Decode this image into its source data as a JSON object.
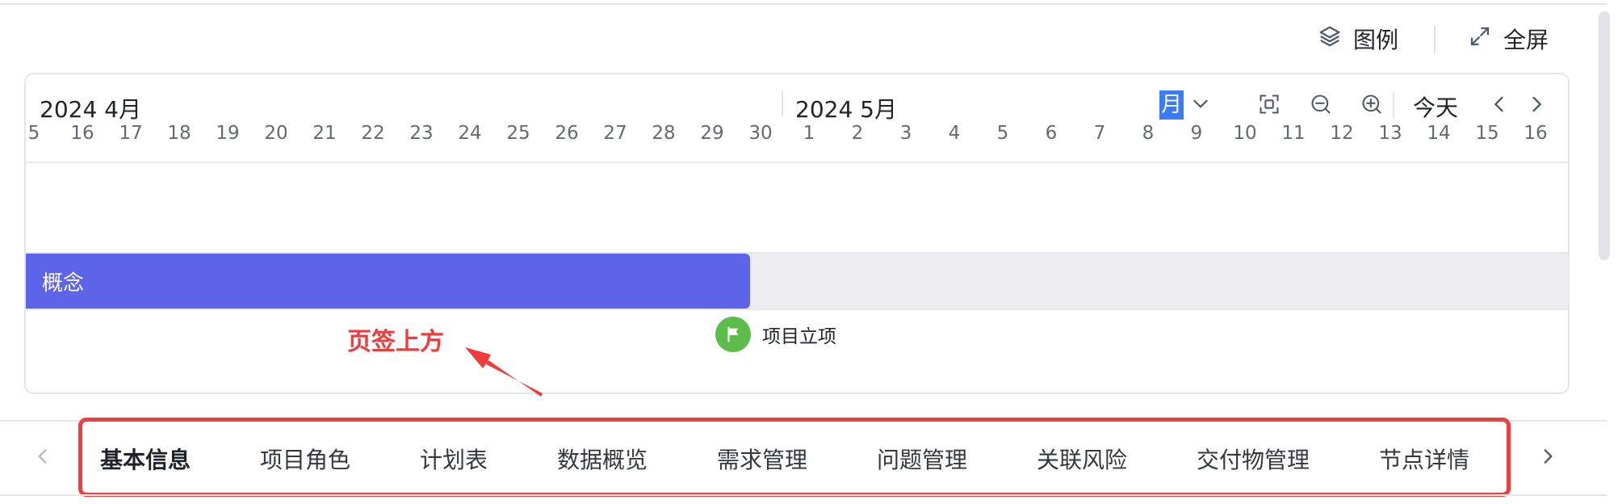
{
  "header": {
    "legend_label": "图例",
    "fullscreen_label": "全屏"
  },
  "gantt": {
    "months": {
      "april": "2024 4月",
      "may": "2024 5月"
    },
    "toolbar": {
      "scale_value": "月",
      "today_label": "今天"
    },
    "days": [
      "5",
      "16",
      "17",
      "18",
      "19",
      "20",
      "21",
      "22",
      "23",
      "24",
      "25",
      "26",
      "27",
      "28",
      "29",
      "30",
      "1",
      "2",
      "3",
      "4",
      "5",
      "6",
      "7",
      "8",
      "9",
      "10",
      "11",
      "12",
      "13",
      "14",
      "15",
      "16"
    ],
    "phase": {
      "label": "概念",
      "color": "#5d64ea",
      "end": "2024-04-30"
    },
    "milestone": {
      "label": "项目立项",
      "date": "2024-05-01",
      "color": "#5cbd4a"
    }
  },
  "annotation": {
    "text": "页签上方",
    "color": "#ee3b3b"
  },
  "tabs": {
    "active_index": 0,
    "items": [
      {
        "label": "基本信息"
      },
      {
        "label": "项目角色"
      },
      {
        "label": "计划表"
      },
      {
        "label": "数据概览"
      },
      {
        "label": "需求管理"
      },
      {
        "label": "问题管理"
      },
      {
        "label": "关联风险"
      },
      {
        "label": "交付物管理"
      },
      {
        "label": "节点详情"
      }
    ]
  },
  "icons": {
    "legend": "layers-icon",
    "fullscreen": "expand-icon",
    "scale_dropdown": "chevron-down-icon",
    "fit": "fit-view-icon",
    "zoom_out": "zoom-out-icon",
    "zoom_in": "zoom-in-icon",
    "prev": "chevron-left-icon",
    "next": "chevron-right-icon",
    "milestone": "flag-icon"
  }
}
